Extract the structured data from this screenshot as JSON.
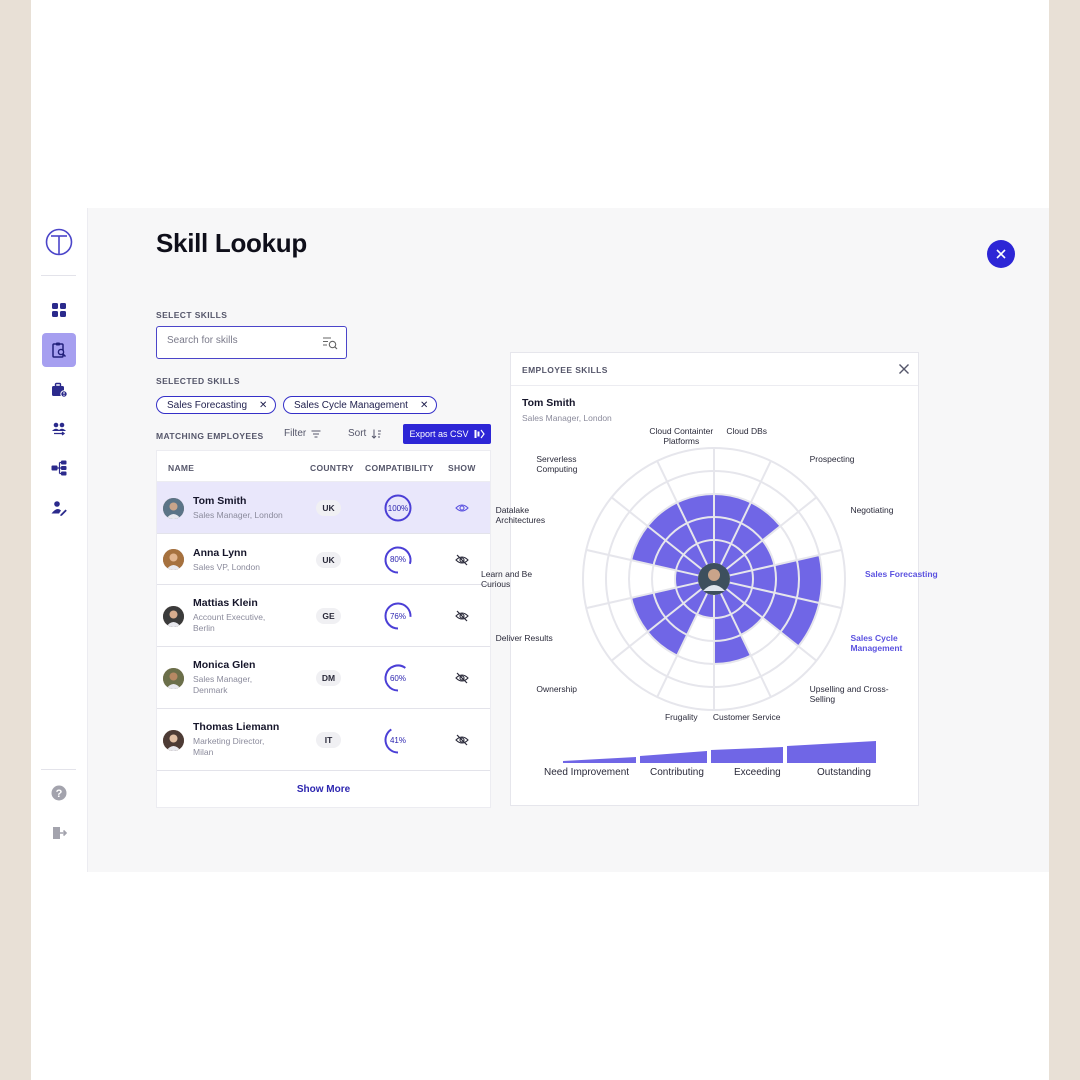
{
  "page": {
    "title": "Skill Lookup"
  },
  "colors": {
    "accent": "#2d26d6",
    "chart_fill": "#7066e6",
    "grid": "#e6e6ec"
  },
  "sidebar": {
    "items": [
      {
        "name": "dashboard-icon",
        "active": false
      },
      {
        "name": "skill-lookup-icon",
        "active": true
      },
      {
        "name": "briefcase-alert-icon",
        "active": false
      },
      {
        "name": "people-swap-icon",
        "active": false
      },
      {
        "name": "org-chart-icon",
        "active": false
      },
      {
        "name": "person-edit-icon",
        "active": false
      }
    ],
    "bottom": [
      {
        "name": "help-icon"
      },
      {
        "name": "logout-icon"
      }
    ]
  },
  "select_skills": {
    "label": "SELECT SKILLS",
    "placeholder": "Search for skills"
  },
  "selected_skills": {
    "label": "SELECTED SKILLS",
    "chips": [
      "Sales Forecasting",
      "Sales Cycle Management"
    ]
  },
  "toolbar": {
    "matching_label": "MATCHING EMPLOYEES",
    "filter_label": "Filter",
    "sort_label": "Sort",
    "export_label": "Export as CSV"
  },
  "table": {
    "headers": [
      "NAME",
      "COUNTRY",
      "COMPATIBILITY",
      "SHOW"
    ],
    "rows": [
      {
        "name": "Tom Smith",
        "role": "Sales Manager, London",
        "country": "UK",
        "compatibility": 100,
        "compatibility_label": "100%",
        "shown": true
      },
      {
        "name": "Anna Lynn",
        "role": "Sales VP, London",
        "country": "UK",
        "compatibility": 80,
        "compatibility_label": "80%",
        "shown": false
      },
      {
        "name": "Mattias Klein",
        "role": "Account Executive, Berlin",
        "country": "GE",
        "compatibility": 76,
        "compatibility_label": "76%",
        "shown": false
      },
      {
        "name": "Monica Glen",
        "role": "Sales Manager, Denmark",
        "country": "DM",
        "compatibility": 60,
        "compatibility_label": "60%",
        "shown": false
      },
      {
        "name": "Thomas Liemann",
        "role": "Marketing Director, Milan",
        "country": "IT",
        "compatibility": 41,
        "compatibility_label": "41%",
        "shown": false
      }
    ],
    "show_more": "Show More"
  },
  "employee_skills": {
    "title": "EMPLOYEE SKILLS",
    "name": "Tom Smith",
    "role": "Sales Manager, London",
    "skills": [
      {
        "label": "Cloud DBs",
        "level": 3,
        "highlight": false
      },
      {
        "label": "Prospecting",
        "level": 3,
        "highlight": false
      },
      {
        "label": "Negotiating",
        "level": 2,
        "highlight": false
      },
      {
        "label": "Sales Forecasting",
        "level": 4,
        "highlight": true
      },
      {
        "label": "Sales Cycle Management",
        "level": 4,
        "highlight": true
      },
      {
        "label": "Upselling and Cross-Selling",
        "level": 2,
        "highlight": false
      },
      {
        "label": "Customer Service",
        "level": 3,
        "highlight": false
      },
      {
        "label": "Frugality",
        "level": 1,
        "highlight": false
      },
      {
        "label": "Ownership",
        "level": 3,
        "highlight": false
      },
      {
        "label": "Deliver Results",
        "level": 3,
        "highlight": false
      },
      {
        "label": "Learn and Be Curious",
        "level": 1,
        "highlight": false
      },
      {
        "label": "Datalake Architectures",
        "level": 3,
        "highlight": false
      },
      {
        "label": "Serverless Computing",
        "level": 3,
        "highlight": false
      },
      {
        "label": "Cloud Containter Platforms",
        "level": 3,
        "highlight": false
      }
    ],
    "legend": [
      "Need Improvement",
      "Contributing",
      "Exceeding",
      "Outstanding"
    ]
  }
}
